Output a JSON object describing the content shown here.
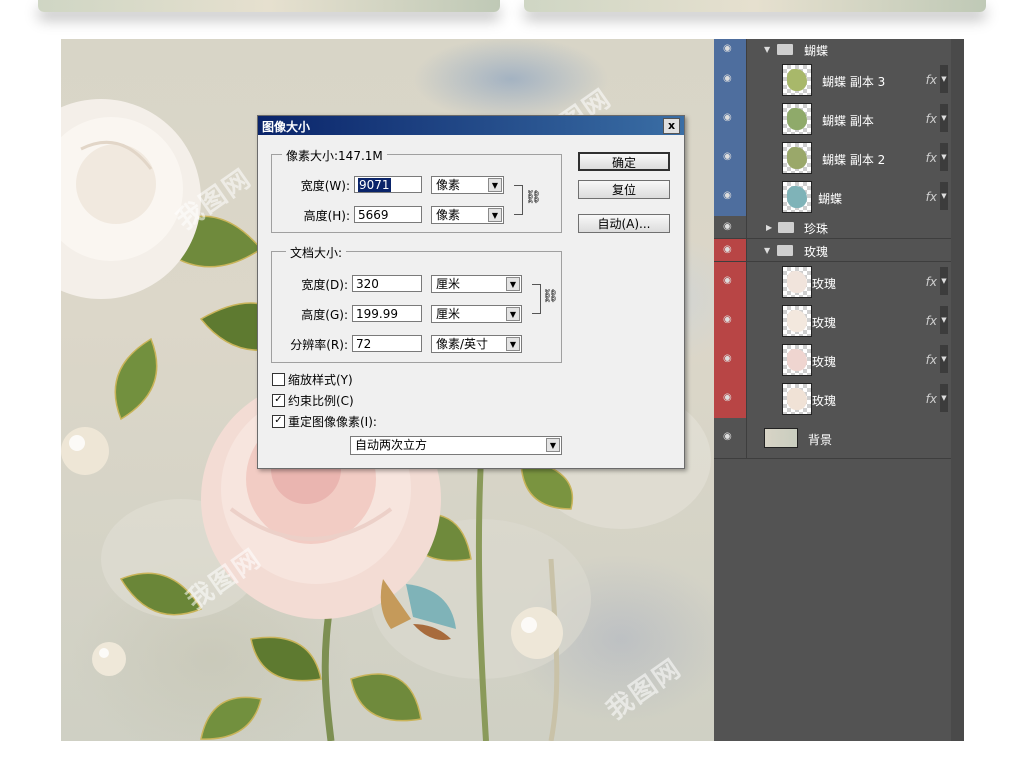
{
  "dialog": {
    "title": "图像大小",
    "close": "x",
    "pixel_dims": {
      "legend": "像素大小:147.1M",
      "width_label": "宽度(W):",
      "width_value": "9071",
      "width_unit": "像素",
      "height_label": "高度(H):",
      "height_value": "5669",
      "height_unit": "像素"
    },
    "doc_size": {
      "legend": "文档大小:",
      "width_label": "宽度(D):",
      "width_value": "320",
      "width_unit": "厘米",
      "height_label": "高度(G):",
      "height_value": "199.99",
      "height_unit": "厘米",
      "res_label": "分辨率(R):",
      "res_value": "72",
      "res_unit": "像素/英寸"
    },
    "buttons": {
      "ok": "确定",
      "reset": "复位",
      "auto": "自动(A)..."
    },
    "checkboxes": [
      {
        "label": "缩放样式(Y)",
        "checked": false
      },
      {
        "label": "约束比例(C)",
        "checked": true
      },
      {
        "label": "重定图像像素(I):",
        "checked": true
      }
    ],
    "resample": "自动两次立方"
  },
  "layers": {
    "groups": [
      {
        "name": "蝴蝶",
        "expanded": true,
        "color": "blue"
      },
      {
        "name": "珍珠",
        "expanded": false
      },
      {
        "name": "玫瑰",
        "expanded": true,
        "color": "red"
      }
    ],
    "items": [
      {
        "name": "蝴蝶 副本 3",
        "fx": "fx"
      },
      {
        "name": "蝴蝶 副本",
        "fx": "fx"
      },
      {
        "name": "蝴蝶 副本 2",
        "fx": "fx"
      },
      {
        "name": "蝴蝶",
        "fx": "fx"
      },
      {
        "name": "玫瑰",
        "fx": "fx"
      },
      {
        "name": "玫瑰",
        "fx": "fx"
      },
      {
        "name": "玫瑰",
        "fx": "fx"
      },
      {
        "name": "玫瑰",
        "fx": "fx"
      },
      {
        "name": "背景"
      }
    ]
  },
  "icons": {
    "eye": "eye-icon",
    "folder": "folder-icon",
    "chain": "chain-link-icon",
    "expand": "triangle-icon"
  }
}
